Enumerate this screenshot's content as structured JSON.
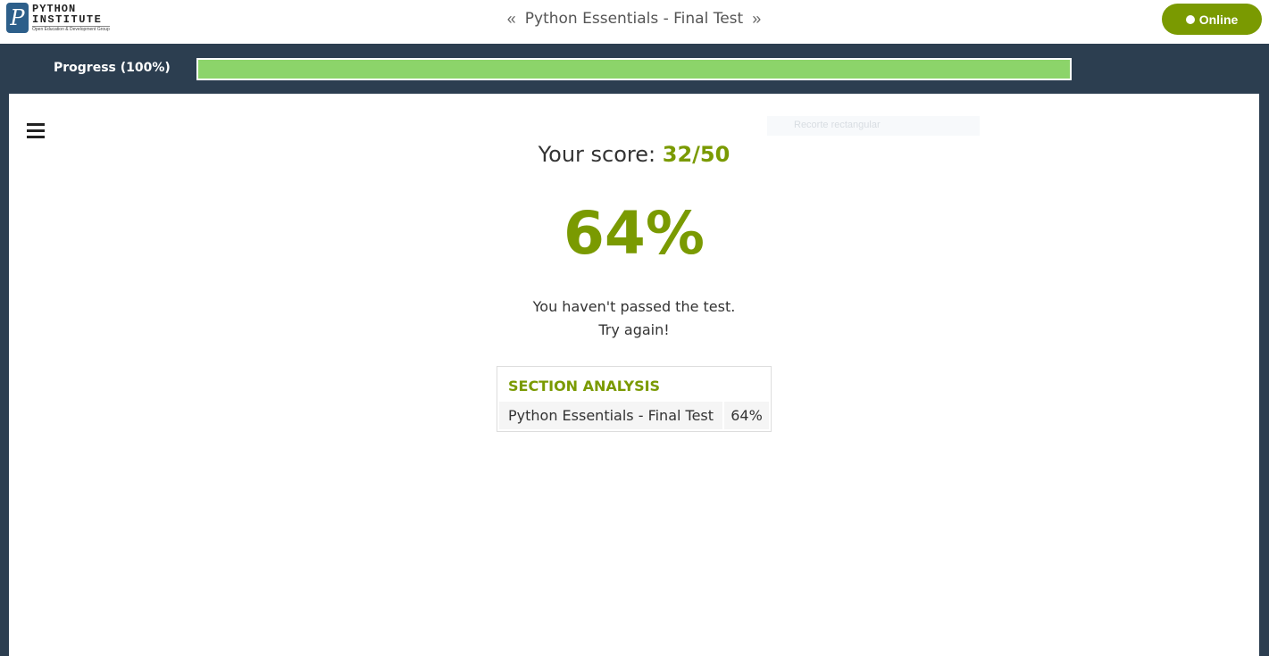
{
  "header": {
    "logo": {
      "mark": "P",
      "line1": "PYTHON",
      "line2": "INSTITUTE",
      "subtitle": "Open Education & Development Group"
    },
    "title": "Python Essentials - Final Test",
    "prev_arrow": "«",
    "next_arrow": "»",
    "status_button": "Online"
  },
  "progress": {
    "label": "Progress (100%)",
    "value_percent": 100,
    "fill_color": "#8cd46a"
  },
  "overlay": {
    "ghost_label": "Recorte rectangular"
  },
  "result": {
    "score_prefix": "Your score:",
    "score_value": "32/50",
    "percent": "64%",
    "message_line1": "You haven't passed the test.",
    "message_line2": "Try again!"
  },
  "section_analysis": {
    "heading": "SECTION ANALYSIS",
    "rows": [
      {
        "name": "Python Essentials - Final Test",
        "value": "64%"
      }
    ]
  },
  "colors": {
    "accent": "#7a9a01",
    "band": "#2c3e50"
  },
  "icons": {
    "menu": "hamburger-menu-icon",
    "prev": "double-chevron-left-icon",
    "next": "double-chevron-right-icon",
    "status": "status-dot-icon"
  }
}
